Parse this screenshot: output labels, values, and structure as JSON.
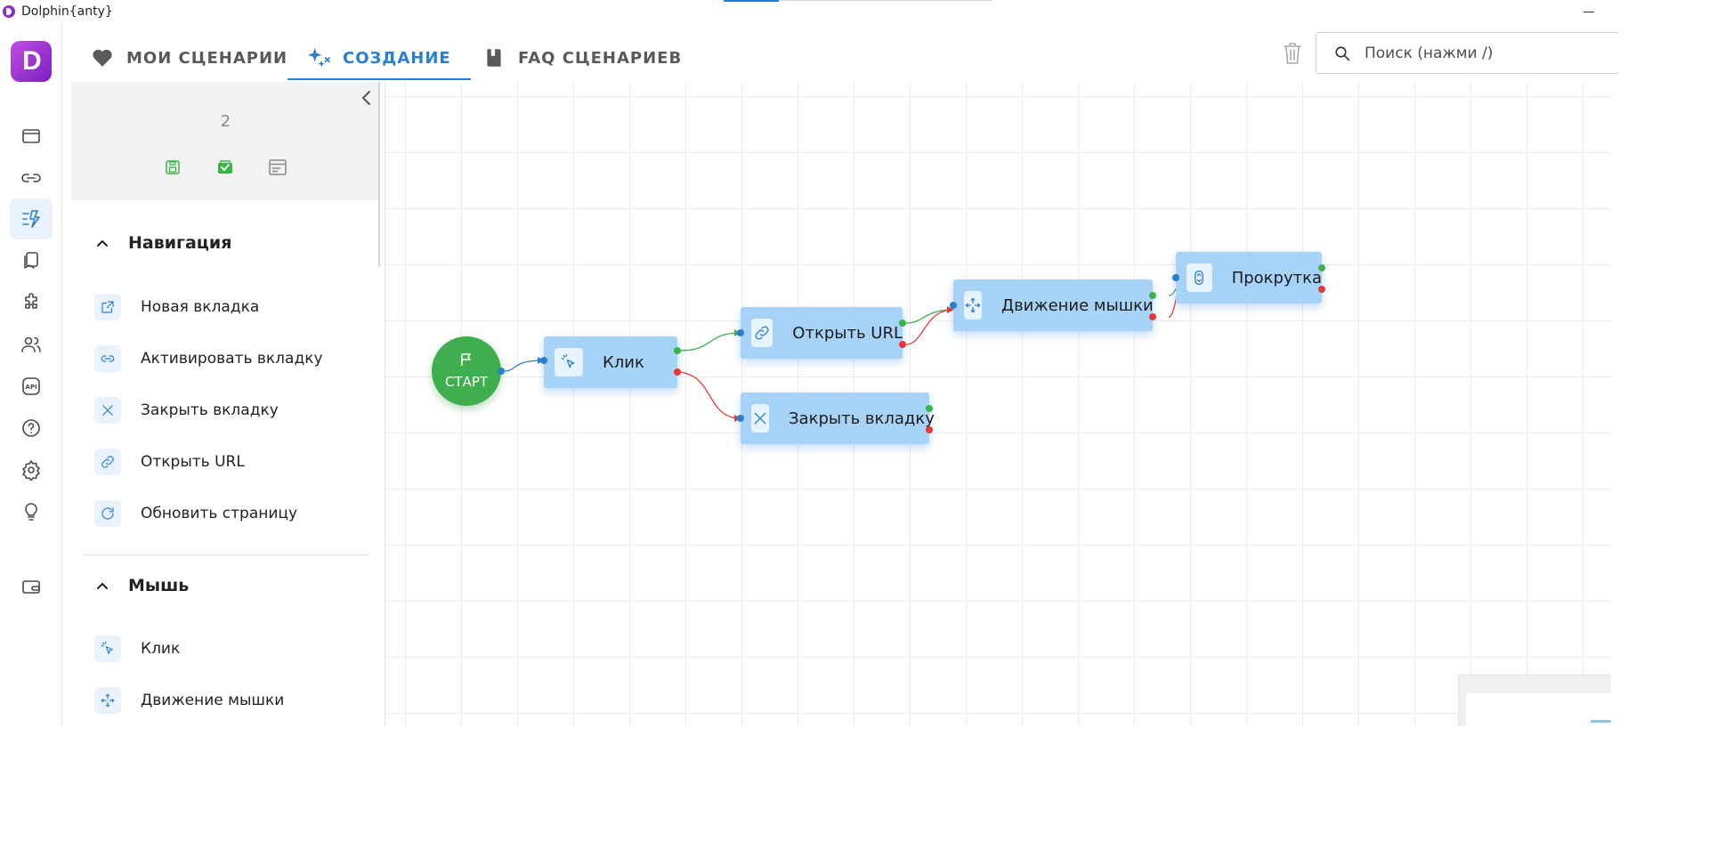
{
  "window": {
    "title": "Dolphin{anty}",
    "brand_letter": "D"
  },
  "rail": {
    "items": [
      {
        "name": "browser-profiles-icon",
        "active": false
      },
      {
        "name": "proxy-link-icon",
        "active": false
      },
      {
        "name": "automation-icon",
        "active": true
      },
      {
        "name": "bookmarks-icon",
        "active": false
      },
      {
        "name": "extensions-puzzle-icon",
        "active": false
      },
      {
        "name": "users-icon",
        "active": false
      },
      {
        "name": "api-icon",
        "active": false
      },
      {
        "name": "help-icon",
        "active": false
      },
      {
        "name": "settings-gear-icon",
        "active": false
      },
      {
        "name": "lightbulb-icon",
        "active": false
      },
      {
        "name": "wallet-icon",
        "active": false
      }
    ],
    "api_label": "API"
  },
  "tabs": [
    {
      "label": "МОИ СЦЕНАРИИ",
      "icon": "heart-icon",
      "active": false
    },
    {
      "label": "СОЗДАНИЕ",
      "icon": "sparkles-icon",
      "active": true
    },
    {
      "label": "FAQ СЦЕНАРИЕВ",
      "icon": "book-icon",
      "active": false
    }
  ],
  "search": {
    "placeholder": "Поиск (нажми /)",
    "value": ""
  },
  "panel": {
    "scenario_name": "2",
    "sections": [
      {
        "title": "Навигация",
        "expanded": true,
        "actions": [
          {
            "label": "Новая вкладка",
            "icon": "new-tab-icon"
          },
          {
            "label": "Активировать вкладку",
            "icon": "link-icon"
          },
          {
            "label": "Закрыть вкладку",
            "icon": "close-icon"
          },
          {
            "label": "Открыть URL",
            "icon": "url-chain-icon"
          },
          {
            "label": "Обновить страницу",
            "icon": "refresh-icon"
          }
        ]
      },
      {
        "title": "Мышь",
        "expanded": true,
        "actions": [
          {
            "label": "Клик",
            "icon": "cursor-click-icon"
          },
          {
            "label": "Движение мышки",
            "icon": "move-arrows-icon"
          }
        ]
      }
    ]
  },
  "canvas": {
    "start": {
      "label": "СТАРТ"
    },
    "nodes": [
      {
        "id": "click",
        "label": "Клик",
        "icon": "cursor-click-icon"
      },
      {
        "id": "open_url",
        "label": "Открыть URL",
        "icon": "url-chain-icon"
      },
      {
        "id": "close_tab",
        "label": "Закрыть вкладку",
        "icon": "close-icon"
      },
      {
        "id": "mouse_move",
        "label": "Движение мышки",
        "icon": "move-arrows-icon"
      },
      {
        "id": "scroll",
        "label": "Прокрутка",
        "icon": "scroll-icon"
      }
    ],
    "edges": [
      {
        "from": "start",
        "to": "click",
        "kind": "next"
      },
      {
        "from": "click",
        "to": "open_url",
        "kind": "success"
      },
      {
        "from": "click",
        "to": "close_tab",
        "kind": "fail"
      },
      {
        "from": "open_url",
        "to": "mouse_move",
        "kind": "success"
      },
      {
        "from": "open_url",
        "to": "mouse_move",
        "kind": "fail"
      },
      {
        "from": "mouse_move",
        "to": "scroll",
        "kind": "success"
      },
      {
        "from": "mouse_move",
        "to": "scroll",
        "kind": "fail"
      }
    ]
  },
  "colors": {
    "accent": "#2a7ed0",
    "node_fill": "#a6d3f7",
    "start_fill": "#3fae4f",
    "success_edge": "#3cb34a",
    "fail_edge": "#e53935"
  }
}
